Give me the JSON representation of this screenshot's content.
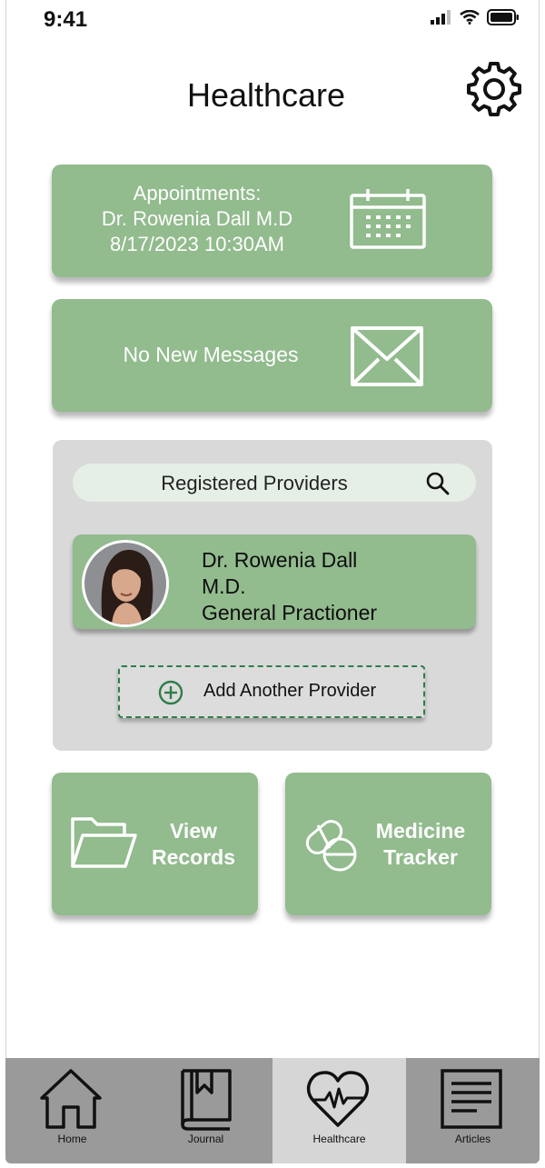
{
  "status_bar": {
    "time": "9:41"
  },
  "header": {
    "title": "Healthcare"
  },
  "appointments": {
    "line1": "Appointments:",
    "line2": "Dr. Rowenia Dall M.D",
    "line3": "8/17/2023 10:30AM"
  },
  "messages": {
    "label": "No New Messages"
  },
  "providers": {
    "search_label": "Registered Providers",
    "items": [
      {
        "name_line1": "Dr. Rowenia Dall",
        "name_line2": "M.D.",
        "specialty": "General Practioner"
      }
    ],
    "add_label": "Add Another Provider"
  },
  "tiles": {
    "records_line1": "View",
    "records_line2": "Records",
    "medicine_line1": "Medicine",
    "medicine_line2": "Tracker"
  },
  "nav": {
    "items": [
      {
        "label": "Home",
        "icon": "home-icon"
      },
      {
        "label": "Journal",
        "icon": "journal-icon"
      },
      {
        "label": "Healthcare",
        "icon": "heart-pulse-icon",
        "active": true
      },
      {
        "label": "Articles",
        "icon": "articles-icon"
      }
    ]
  },
  "colors": {
    "card_green": "#92bb8e",
    "panel_gray": "#d9d9d9",
    "nav_gray": "#9a9a9a",
    "nav_active": "#d6d6d6",
    "accent_dark_green": "#2f7d4a"
  }
}
